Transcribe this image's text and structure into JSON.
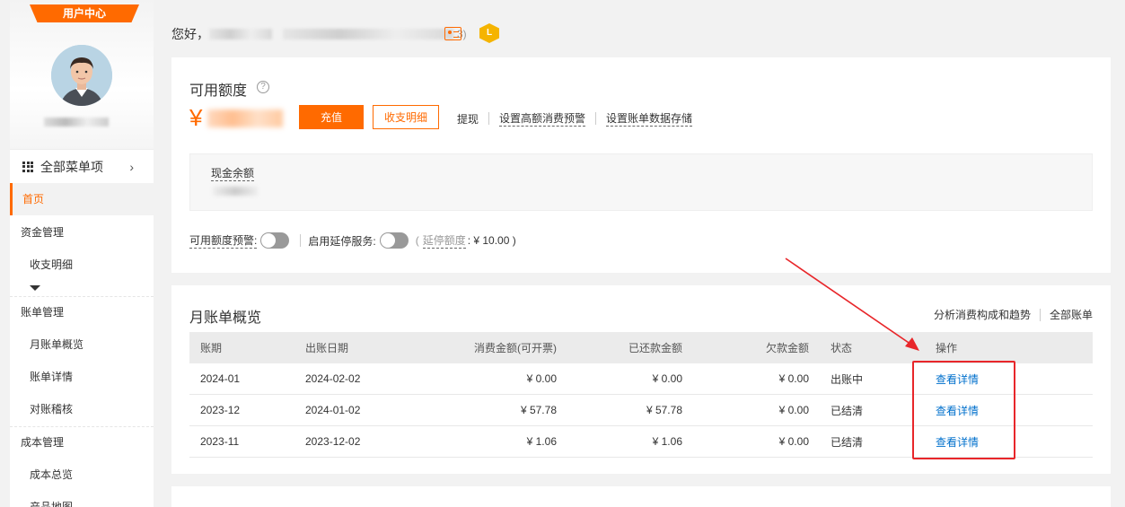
{
  "sidebar": {
    "user_center_label": "用户中心",
    "all_menu_label": "全部菜单项",
    "items": [
      {
        "label": "首页",
        "level": 1,
        "active": true
      },
      {
        "label": "资金管理",
        "level": 1
      },
      {
        "label": "收支明细",
        "level": 2
      },
      {
        "label": "账单管理",
        "level": 1
      },
      {
        "label": "月账单概览",
        "level": 2
      },
      {
        "label": "账单详情",
        "level": 2
      },
      {
        "label": "对账稽核",
        "level": 2
      },
      {
        "label": "成本管理",
        "level": 1
      },
      {
        "label": "成本总览",
        "level": 2
      },
      {
        "label": "产品地图",
        "level": 2
      }
    ]
  },
  "header": {
    "greeting": "您好，",
    "account_id_paren_close": "3)"
  },
  "available_quota": {
    "title": "可用额度",
    "currency_symbol": "¥",
    "recharge_label": "充值",
    "income_expense_label": "收支明细",
    "links": [
      "提现",
      "设置高额消费预警",
      "设置账单数据存储"
    ],
    "cash_balance_label": "现金余额",
    "quota_alert_label": "可用额度预警:",
    "delay_stop_label": "启用延停服务:",
    "delay_quota_prefix": "(",
    "delay_quota_label": "延停额度",
    "delay_quota_value": ": ¥ 10.00 )"
  },
  "monthly_bill": {
    "title": "月账单概览",
    "analyze_link": "分析消费构成和趋势",
    "all_bills_link": "全部账单",
    "columns": [
      "账期",
      "出账日期",
      "消费金额(可开票)",
      "已还款金额",
      "欠款金额",
      "状态",
      "操作"
    ],
    "rows": [
      {
        "period": "2024-01",
        "bill_date": "2024-02-02",
        "consumption": "¥ 0.00",
        "repaid": "¥ 0.00",
        "owed": "¥ 0.00",
        "status": "出账中",
        "action": "查看详情"
      },
      {
        "period": "2023-12",
        "bill_date": "2024-01-02",
        "consumption": "¥ 57.78",
        "repaid": "¥ 57.78",
        "owed": "¥ 0.00",
        "status": "已结清",
        "action": "查看详情"
      },
      {
        "period": "2023-11",
        "bill_date": "2023-12-02",
        "consumption": "¥ 1.06",
        "repaid": "¥ 1.06",
        "owed": "¥ 0.00",
        "status": "已结清",
        "action": "查看详情"
      }
    ]
  },
  "colors": {
    "brand_orange": "#ff6a00",
    "link_blue": "#0070cc",
    "annotation_red": "#e8262a"
  }
}
